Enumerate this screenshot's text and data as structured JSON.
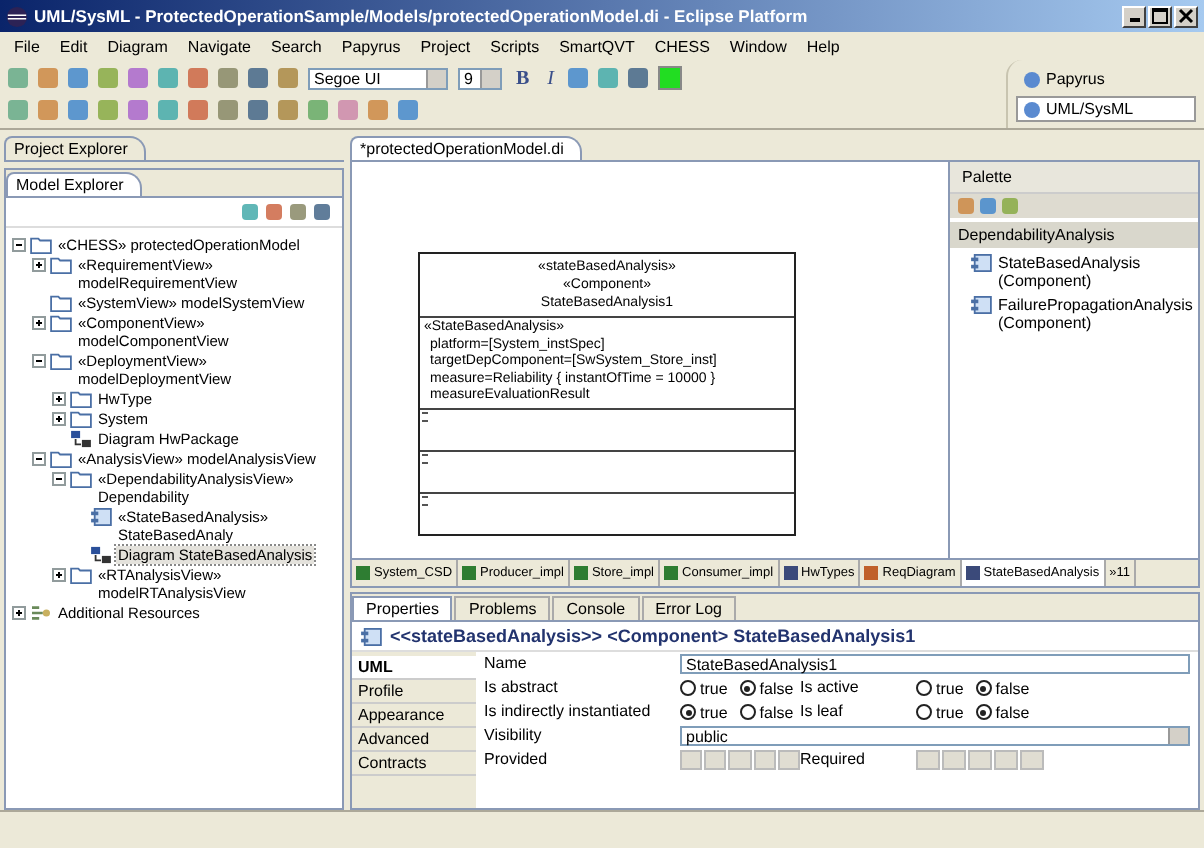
{
  "window": {
    "title": "UML/SysML - ProtectedOperationSample/Models/protectedOperationModel.di - Eclipse Platform"
  },
  "menu": [
    "File",
    "Edit",
    "Diagram",
    "Navigate",
    "Search",
    "Papyrus",
    "Project",
    "Scripts",
    "SmartQVT",
    "CHESS",
    "Window",
    "Help"
  ],
  "toolbar": {
    "font": "Segoe UI",
    "size": "9",
    "bold": "B",
    "italic": "I"
  },
  "perspectives": [
    {
      "label": "Papyrus",
      "selected": false
    },
    {
      "label": "UML/SysML",
      "selected": true
    }
  ],
  "project_explorer": {
    "title": "Project Explorer"
  },
  "model_explorer": {
    "title": "Model Explorer",
    "tree": [
      {
        "label": "«CHESS» protectedOperationModel",
        "kind": "folder",
        "expanded": true,
        "selected": false,
        "children": [
          {
            "label": "«RequirementView» modelRequirementView",
            "kind": "folder",
            "expanded": false,
            "selected": false
          },
          {
            "label": "«SystemView» modelSystemView",
            "kind": "folder",
            "selected": false
          },
          {
            "label": "«ComponentView» modelComponentView",
            "kind": "folder",
            "expanded": false,
            "selected": false
          },
          {
            "label": "«DeploymentView» modelDeploymentView",
            "kind": "folder",
            "expanded": true,
            "selected": false,
            "children": [
              {
                "label": "HwType",
                "kind": "folder",
                "expanded": false,
                "selected": false
              },
              {
                "label": "System",
                "kind": "folder",
                "expanded": false,
                "selected": false
              },
              {
                "label": "Diagram HwPackage",
                "kind": "diagram",
                "selected": false
              }
            ]
          },
          {
            "label": "«AnalysisView» modelAnalysisView",
            "kind": "folder",
            "expanded": true,
            "selected": false,
            "children": [
              {
                "label": "«DependabilityAnalysisView» Dependability",
                "kind": "folder",
                "expanded": true,
                "selected": false,
                "children": [
                  {
                    "label": "«StateBasedAnalysis» StateBasedAnaly",
                    "kind": "component",
                    "selected": false
                  },
                  {
                    "label": "Diagram StateBasedAnalysis",
                    "kind": "diagram",
                    "selected": true
                  }
                ]
              },
              {
                "label": "«RTAnalysisView» modelRTAnalysisView",
                "kind": "folder",
                "expanded": false,
                "selected": false
              }
            ]
          }
        ]
      },
      {
        "label": "Additional Resources",
        "kind": "resources",
        "expanded": false,
        "selected": false
      }
    ]
  },
  "editor": {
    "tab": "*protectedOperationModel.di",
    "diagram": {
      "header": [
        "«stateBasedAnalysis»",
        "«Component»",
        "StateBasedAnalysis1"
      ],
      "attributes": [
        "«StateBasedAnalysis»",
        "platform=[System_instSpec]",
        "targetDepComponent=[SwSystem_Store_inst]",
        "measure=Reliability { instantOfTime = 10000 }",
        "measureEvaluationResult"
      ]
    }
  },
  "palette": {
    "title": "Palette",
    "drawer": "DependabilityAnalysis",
    "tools": [
      "StateBasedAnalysis (Component)",
      "FailurePropagationAnalysis (Component)"
    ]
  },
  "diagram_tabs": [
    {
      "label": "System_CSD",
      "kind": "composite",
      "selected": false
    },
    {
      "label": "Producer_impl",
      "kind": "composite",
      "selected": false
    },
    {
      "label": "Store_impl",
      "kind": "composite",
      "selected": false
    },
    {
      "label": "Consumer_impl",
      "kind": "composite",
      "selected": false
    },
    {
      "label": "HwTypes",
      "kind": "deployment",
      "selected": false
    },
    {
      "label": "ReqDiagram",
      "kind": "requirement",
      "selected": false
    },
    {
      "label": "StateBasedAnalysis",
      "kind": "deployment",
      "selected": true
    }
  ],
  "diagram_tabs_overflow": "»11",
  "properties": {
    "tabs": [
      {
        "label": "Properties",
        "selected": true
      },
      {
        "label": "Problems",
        "selected": false
      },
      {
        "label": "Console",
        "selected": false
      },
      {
        "label": "Error Log",
        "selected": false
      }
    ],
    "header": "<<stateBasedAnalysis>> <Component> StateBasedAnalysis1",
    "sections": [
      {
        "label": "UML",
        "selected": true
      },
      {
        "label": "Profile",
        "selected": false
      },
      {
        "label": "Appearance",
        "selected": false
      },
      {
        "label": "Advanced",
        "selected": false
      },
      {
        "label": "Contracts",
        "selected": false
      }
    ],
    "name": {
      "label": "Name",
      "value": "StateBasedAnalysis1"
    },
    "flags": [
      {
        "label": "Is abstract",
        "options": [
          {
            "label": "true",
            "selected": false
          },
          {
            "label": "false",
            "selected": true
          }
        ]
      },
      {
        "label": "Is active",
        "options": [
          {
            "label": "true",
            "selected": false
          },
          {
            "label": "false",
            "selected": true
          }
        ]
      },
      {
        "label": "Is indirectly instantiated",
        "options": [
          {
            "label": "true",
            "selected": true
          },
          {
            "label": "false",
            "selected": false
          }
        ]
      },
      {
        "label": "Is leaf",
        "options": [
          {
            "label": "true",
            "selected": false
          },
          {
            "label": "false",
            "selected": true
          }
        ]
      }
    ],
    "visibility": {
      "label": "Visibility",
      "value": "public"
    },
    "lists": [
      "Provided",
      "Required"
    ]
  }
}
